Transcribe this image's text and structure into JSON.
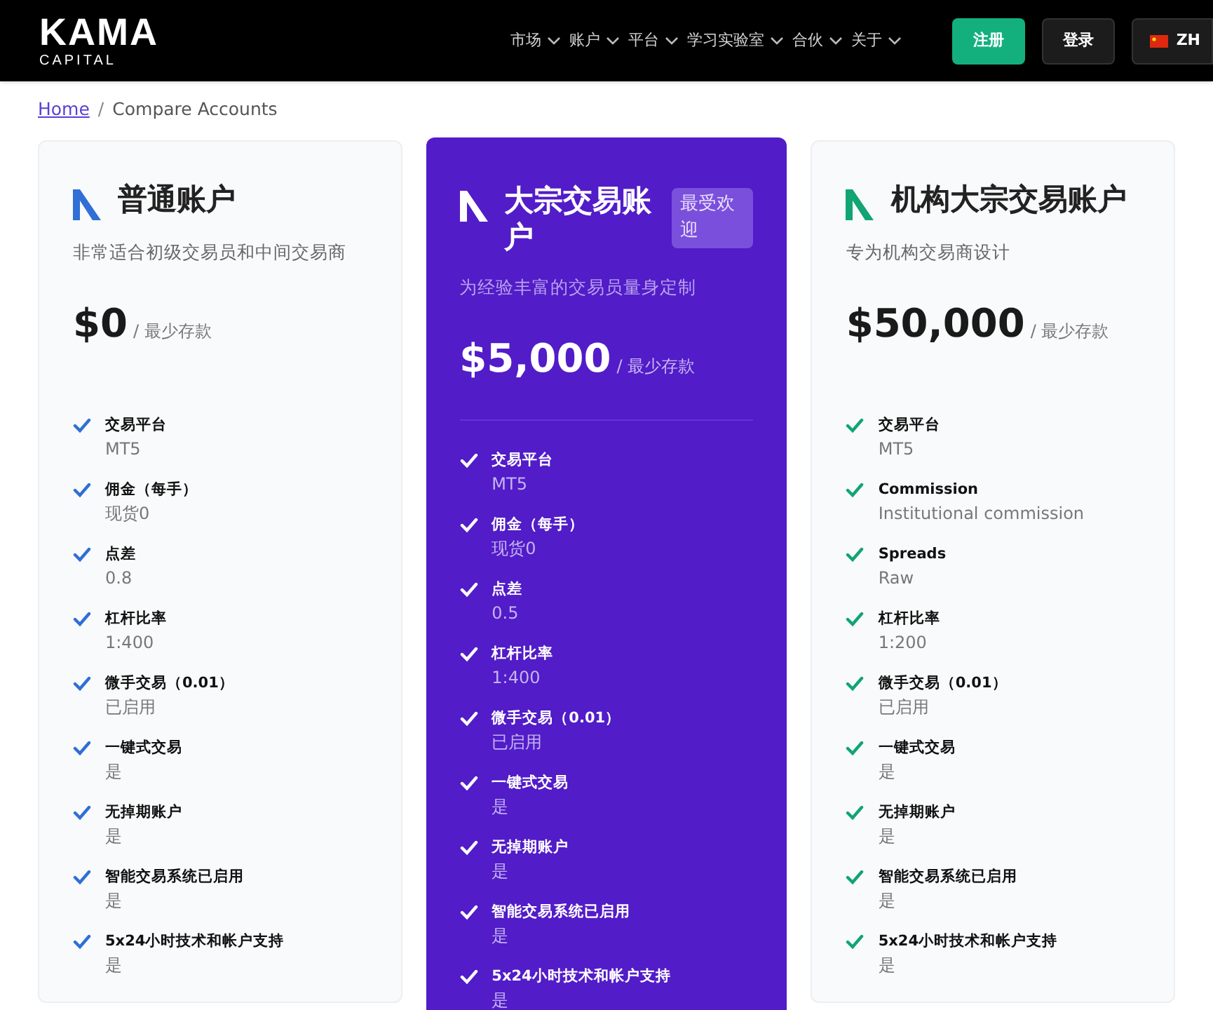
{
  "header": {
    "logo": {
      "wordmark": "KAMA",
      "tagline": "CAPITAL"
    },
    "nav": [
      {
        "label": "市场"
      },
      {
        "label": "账户"
      },
      {
        "label": "平台"
      },
      {
        "label": "学习实验室"
      },
      {
        "label": "合伙"
      },
      {
        "label": "关于"
      }
    ],
    "register": "注册",
    "login": "登录",
    "language": "ZH"
  },
  "breadcrumb": {
    "link": "Home",
    "separator": "/",
    "current": "Compare Accounts"
  },
  "cards": [
    {
      "title": "普通账户",
      "highlighted": false,
      "color": "#2f6fd6",
      "subtitle": "非常适合初级交易员和中间交易商",
      "price": "$0",
      "price_note": "/ 最少存款",
      "features": [
        {
          "label": "交易平台",
          "value": "MT5"
        },
        {
          "label": "佣金（每手）",
          "value": "现货0"
        },
        {
          "label": "点差",
          "value": "0.8"
        },
        {
          "label": "杠杆比率",
          "value": "1:400"
        },
        {
          "label": "微手交易（0.01）",
          "value": "已启用"
        },
        {
          "label": "一键式交易",
          "value": "是"
        },
        {
          "label": "无掉期账户",
          "value": "是"
        },
        {
          "label": "智能交易系统已启用",
          "value": "是"
        },
        {
          "label": "5x24小时技术和帐户支持",
          "value": "是"
        }
      ]
    },
    {
      "title": "大宗交易账户",
      "highlighted": true,
      "color": "#ffffff",
      "badge": "最受欢迎",
      "subtitle": "为经验丰富的交易员量身定制",
      "price": "$5,000",
      "price_note": "/ 最少存款",
      "features": [
        {
          "label": "交易平台",
          "value": "MT5"
        },
        {
          "label": "佣金（每手）",
          "value": "现货0"
        },
        {
          "label": "点差",
          "value": "0.5"
        },
        {
          "label": "杠杆比率",
          "value": "1:400"
        },
        {
          "label": "微手交易（0.01）",
          "value": "已启用"
        },
        {
          "label": "一键式交易",
          "value": "是"
        },
        {
          "label": "无掉期账户",
          "value": "是"
        },
        {
          "label": "智能交易系统已启用",
          "value": "是"
        },
        {
          "label": "5x24小时技术和帐户支持",
          "value": "是"
        }
      ]
    },
    {
      "title": "机构大宗交易账户",
      "highlighted": false,
      "color": "#10a572",
      "subtitle": "专为机构交易商设计",
      "price": "$50,000",
      "price_note": "/ 最少存款",
      "features": [
        {
          "label": "交易平台",
          "value": "MT5"
        },
        {
          "label": "Commission",
          "value": "Institutional commission"
        },
        {
          "label": "Spreads",
          "value": "Raw"
        },
        {
          "label": "杠杆比率",
          "value": "1:200"
        },
        {
          "label": "微手交易（0.01）",
          "value": "已启用"
        },
        {
          "label": "一键式交易",
          "value": "是"
        },
        {
          "label": "无掉期账户",
          "value": "是"
        },
        {
          "label": "智能交易系统已启用",
          "value": "是"
        },
        {
          "label": "5x24小时技术和帐户支持",
          "value": "是"
        }
      ]
    }
  ]
}
